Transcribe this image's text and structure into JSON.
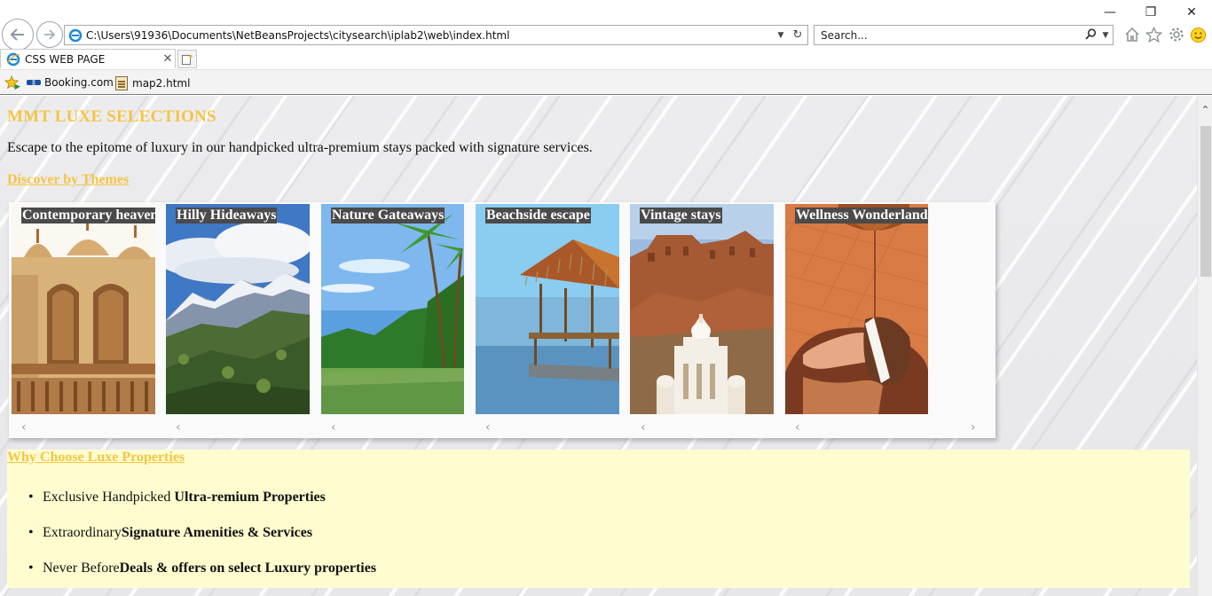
{
  "browser": {
    "address_url": "C:\\Users\\91936\\Documents\\NetBeansProjects\\citysearch\\iplab2\\web\\index.html",
    "search_placeholder": "Search...",
    "tab_title": "CSS WEB PAGE",
    "favorites": [
      {
        "label": "Booking.com",
        "icon": "booking-icon"
      },
      {
        "label": "map2.html",
        "icon": "page-icon"
      }
    ],
    "window_controls": {
      "minimize": "—",
      "restore": "❐",
      "close": "✕"
    }
  },
  "page": {
    "heading": "MMT LUXE SELECTIONS",
    "intro": "Escape to the epitome of luxury in our handpicked ultra-premium stays packed with signature services.",
    "themes_heading": "Discover by Themes",
    "themes": [
      {
        "label": "Contemporary heavens"
      },
      {
        "label": "Hilly Hideaways"
      },
      {
        "label": "Nature Gateaways"
      },
      {
        "label": "Beachside escape"
      },
      {
        "label": "Vintage stays"
      },
      {
        "label": "Wellness Wonderland"
      }
    ],
    "why_heading": "Why Choose Luxe Properties",
    "why_items": [
      {
        "normal": "Exclusive Handpicked ",
        "bold": "Ultra-remium Properties"
      },
      {
        "normal": "Extraordinary",
        "bold": "Signature Amenities & Services"
      },
      {
        "normal": "Never Before",
        "bold": "Deals & offers on select Luxury properties"
      }
    ],
    "colors": {
      "heading": "#f5c542",
      "why_background": "#fffdcf",
      "label_background": "#4a4a4a"
    }
  }
}
